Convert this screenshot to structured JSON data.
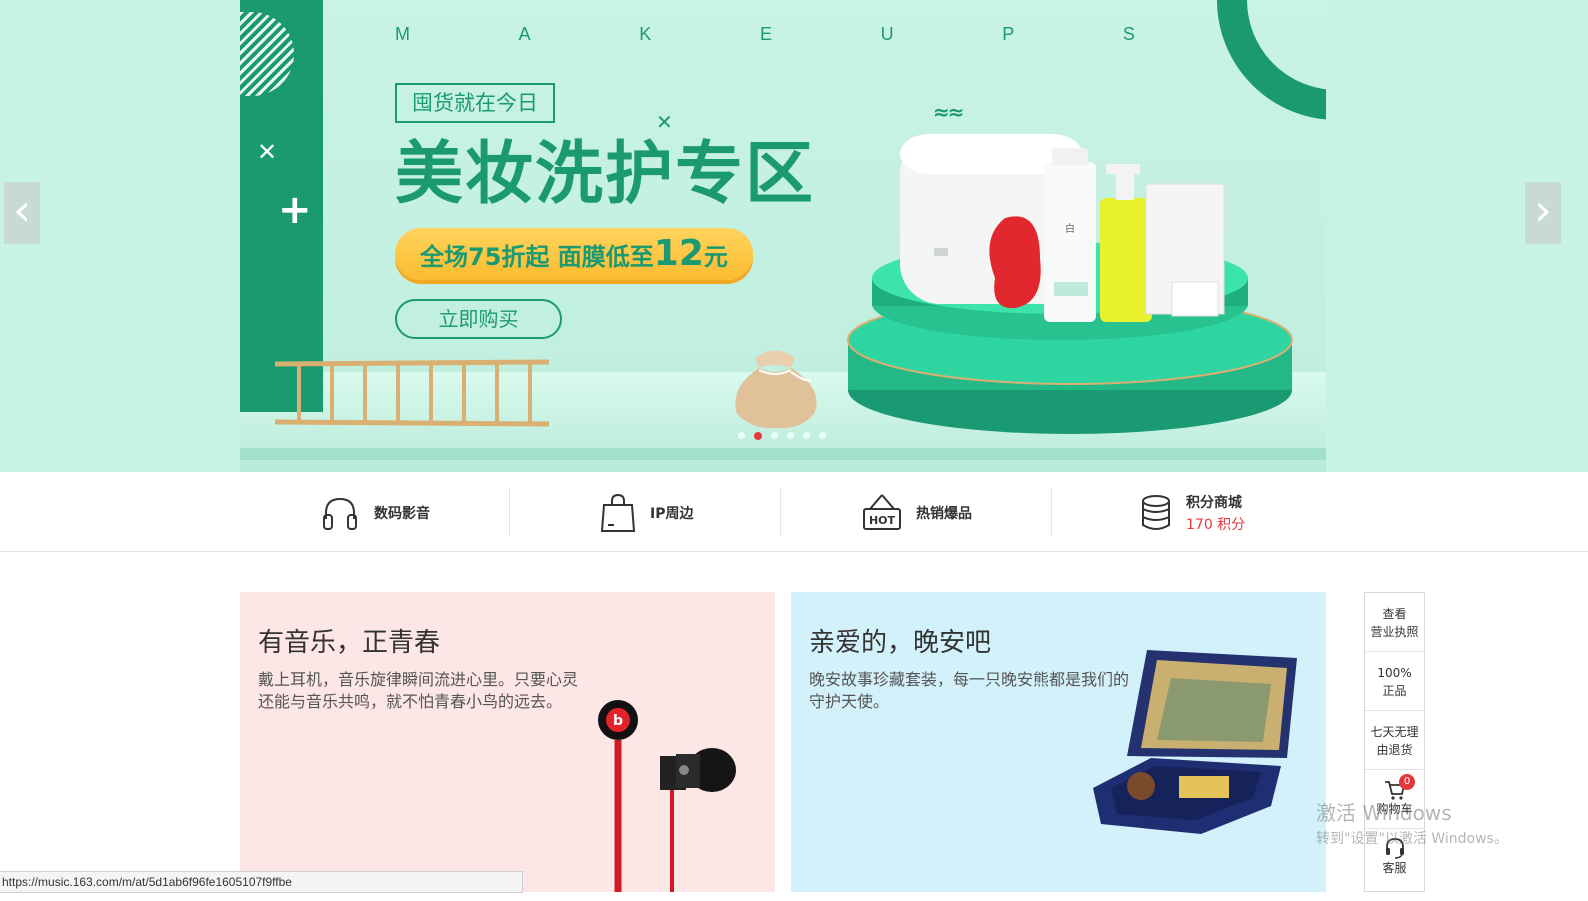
{
  "banner": {
    "letters": [
      "M",
      "A",
      "K",
      "E",
      "U",
      "P",
      "S"
    ],
    "tag": "囤货就在今日",
    "headline": "美妆洗护专区",
    "discount_prefix": "全场75折起 面膜低至",
    "discount_num": "12",
    "discount_unit": "元",
    "cta": "立即购买",
    "slide_count": 6,
    "active_slide": 2,
    "colors": {
      "brand_green": "#1b9a72",
      "bg_mint": "#c8f2e4",
      "pill_yellow": "#fbbb2f",
      "active_dot": "#e4393c"
    }
  },
  "categories": [
    {
      "label": "数码影音",
      "icon": "headphones-icon"
    },
    {
      "label": "IP周边",
      "icon": "shopping-bag-icon"
    },
    {
      "label": "热销爆品",
      "icon": "hot-sign-icon"
    },
    {
      "label": "积分商城",
      "sub": "170 积分",
      "icon": "coin-stack-icon"
    }
  ],
  "cards": [
    {
      "title": "有音乐，正青春",
      "desc": "戴上耳机，音乐旋律瞬间流进心里。只要心灵还能与音乐共鸣，就不怕青春小鸟的远去。"
    },
    {
      "title": "亲爱的，晚安吧",
      "desc": "晚安故事珍藏套装，每一只晚安熊都是我们的守护天使。"
    }
  ],
  "sidebar": {
    "license": [
      "查看",
      "营业执照"
    ],
    "genuine": [
      "100%",
      "正品"
    ],
    "returns": [
      "七天无理",
      "由退货"
    ],
    "cart": "购物车",
    "cart_count": "0",
    "service": "客服"
  },
  "watermark": {
    "line1": "激活 Windows",
    "line2": "转到\"设置\"以激活 Windows。"
  },
  "status_url": "https://music.163.com/m/at/5d1ab6f96fe1605107f9ffbe"
}
